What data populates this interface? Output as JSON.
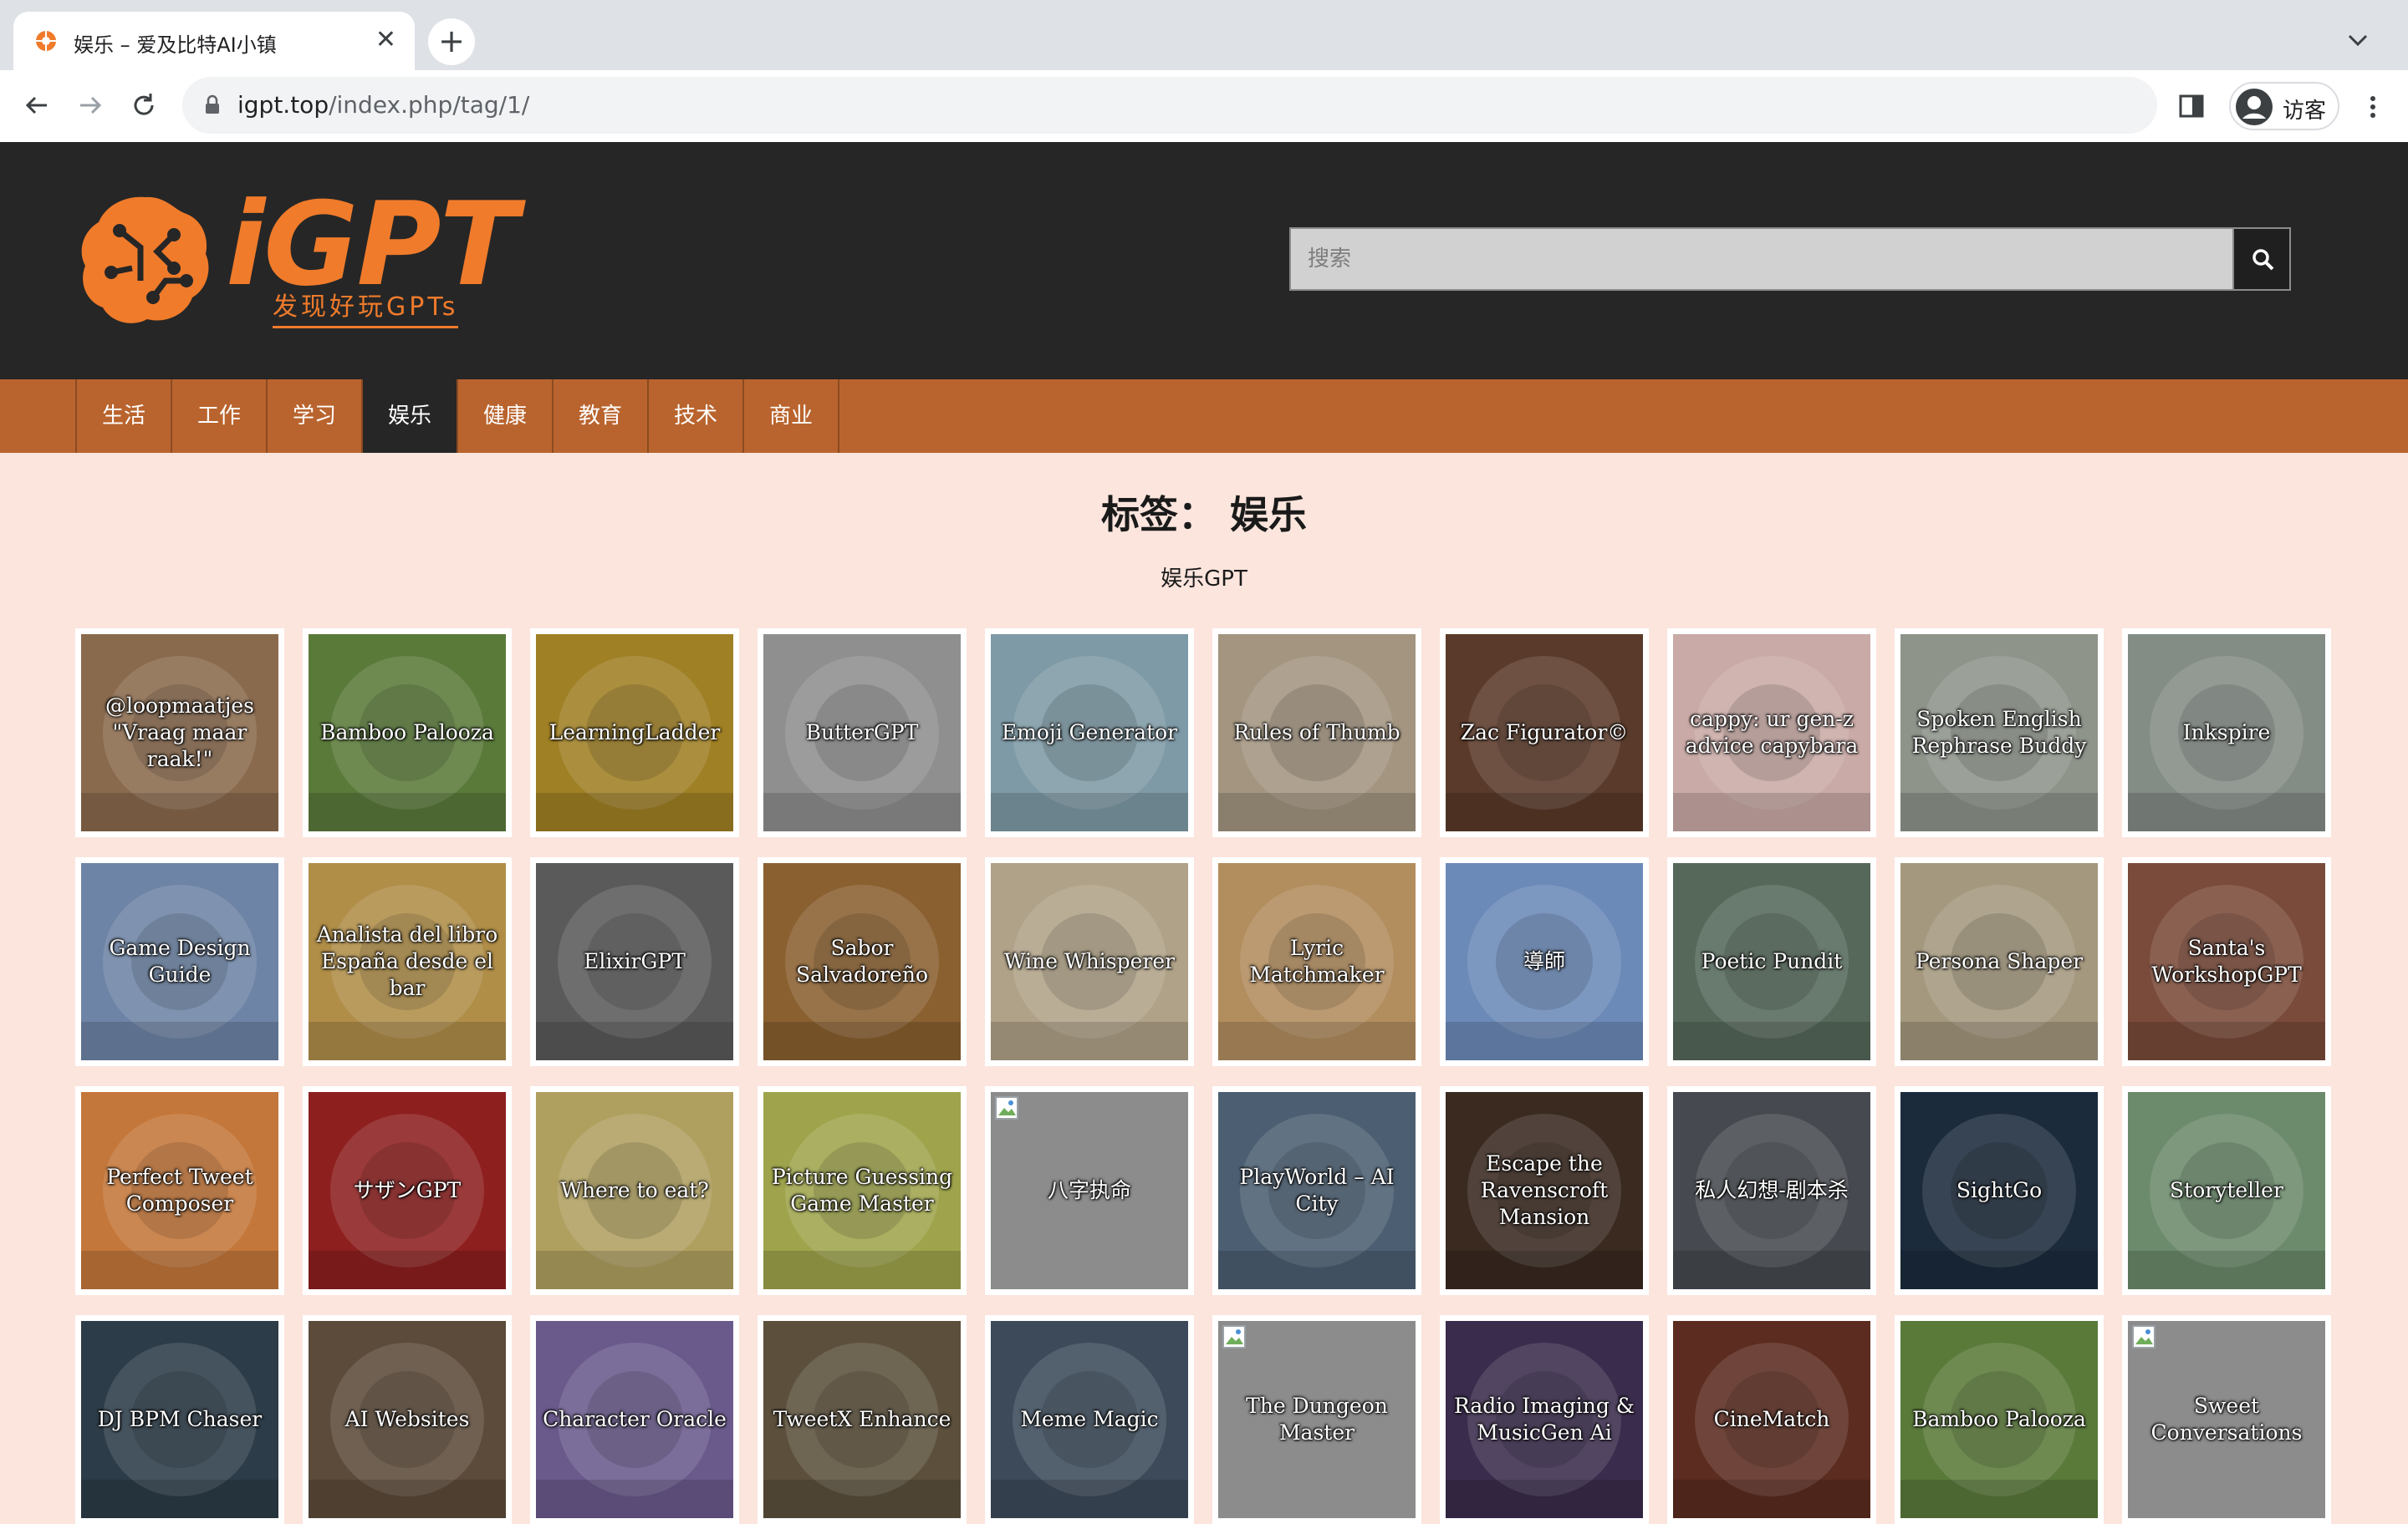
{
  "browser": {
    "tab_title": "娱乐 – 爱及比特AI小镇",
    "url_host": "igpt.top",
    "url_path": "/index.php/tag/1/",
    "profile_label": "访客"
  },
  "site": {
    "logo_text": "iGPT",
    "logo_tagline": "发现好玩GPTs",
    "search_placeholder": "搜索"
  },
  "nav": {
    "items": [
      "生活",
      "工作",
      "学习",
      "娱乐",
      "健康",
      "教育",
      "技术",
      "商业"
    ],
    "active_index": 3
  },
  "page": {
    "title": "标签： 娱乐",
    "description": "娱乐GPT"
  },
  "cards": [
    {
      "name": "@loopmaatjes \"Vraag maar raak!\"",
      "color": "#8a6a4d"
    },
    {
      "name": "Bamboo Palooza",
      "color": "#5a7a3a"
    },
    {
      "name": "LearningLadder",
      "color": "#a08025"
    },
    {
      "name": "ButterGPT",
      "color": "#8f8f8f"
    },
    {
      "name": "Emoji Generator",
      "color": "#7e9aa6"
    },
    {
      "name": "Rules of Thumb",
      "color": "#a39580"
    },
    {
      "name": "Zac Figurator©",
      "color": "#5a3a2a"
    },
    {
      "name": "cappy: ur gen-z advice capybara",
      "color": "#c9aaa6"
    },
    {
      "name": "Spoken English Rephrase Buddy",
      "color": "#8e948a"
    },
    {
      "name": "Inkspire",
      "color": "#848c86"
    },
    {
      "name": "Game Design Guide",
      "color": "#6e84a6"
    },
    {
      "name": "Analista del libro España desde el bar",
      "color": "#b08e48"
    },
    {
      "name": "ElixirGPT",
      "color": "#5a5a5a"
    },
    {
      "name": "Sabor Salvadoreño",
      "color": "#8a6030"
    },
    {
      "name": "Wine Whisperer",
      "color": "#b0a288"
    },
    {
      "name": "Lyric Matchmaker",
      "color": "#b28d5e"
    },
    {
      "name": "導師",
      "color": "#6c8ab8"
    },
    {
      "name": "Poetic Pundit",
      "color": "#55685a"
    },
    {
      "name": "Persona Shaper",
      "color": "#a4987e"
    },
    {
      "name": "Santa's WorkshopGPT",
      "color": "#7a4a3a"
    },
    {
      "name": "Perfect Tweet Composer",
      "color": "#c4773a"
    },
    {
      "name": "サザンGPT",
      "color": "#8e1f1f"
    },
    {
      "name": "Where to eat?",
      "color": "#b0a060"
    },
    {
      "name": "Picture Guessing Game Master",
      "color": "#9fa44c"
    },
    {
      "name": "八字执命",
      "color": "#8c8c8c",
      "broken": true
    },
    {
      "name": "PlayWorld – AI City",
      "color": "#4c5f72"
    },
    {
      "name": "Escape the Ravenscroft Mansion",
      "color": "#3a2a20"
    },
    {
      "name": "私人幻想-剧本杀",
      "color": "#464a50"
    },
    {
      "name": "SightGo",
      "color": "#1c2b3c"
    },
    {
      "name": "Storyteller",
      "color": "#6c8a6c"
    },
    {
      "name": "DJ BPM Chaser",
      "color": "#2c3c48"
    },
    {
      "name": "AI Websites",
      "color": "#5c4a3a"
    },
    {
      "name": "Character Oracle",
      "color": "#6a5a8c"
    },
    {
      "name": "TweetX Enhance",
      "color": "#5c503c"
    },
    {
      "name": "Meme Magic",
      "color": "#3c4a5a"
    },
    {
      "name": "The Dungeon Master",
      "color": "#8c8c8c",
      "broken": true
    },
    {
      "name": "Radio Imaging & MusicGen Ai",
      "color": "#3a2c4c"
    },
    {
      "name": "CineMatch",
      "color": "#5c2c20"
    },
    {
      "name": "Bamboo Palooza",
      "color": "#5a7a3a"
    },
    {
      "name": "Sweet Conversations",
      "color": "#8c8c8c",
      "broken": true
    }
  ]
}
